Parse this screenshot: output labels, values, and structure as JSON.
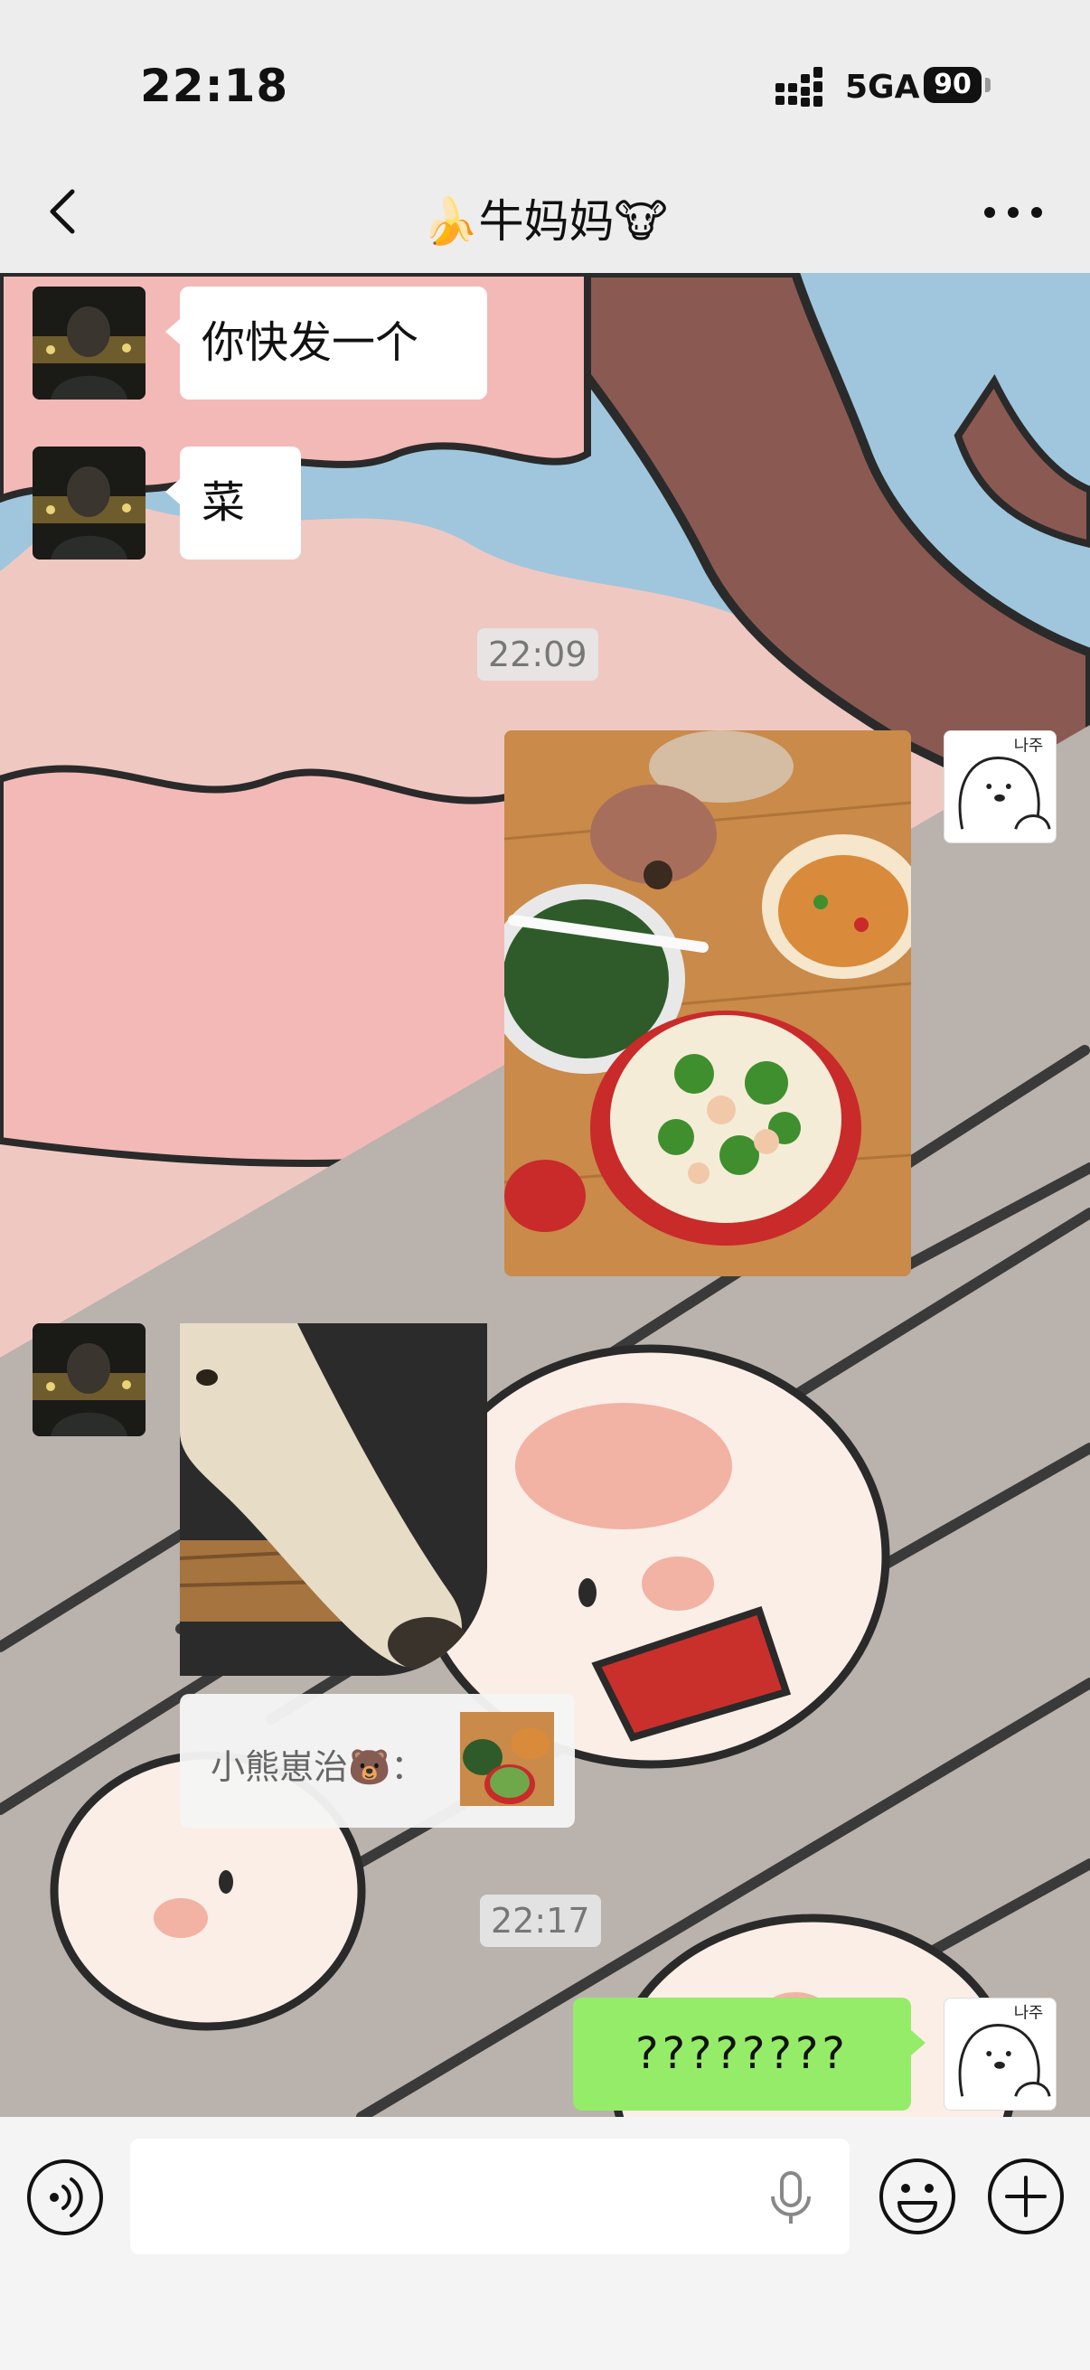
{
  "status_bar": {
    "time": "22:18",
    "network": "5GA",
    "battery": "90"
  },
  "nav": {
    "title": "🍌牛妈妈🐮",
    "back_icon": "chevron-left-icon",
    "more_icon": "ellipsis-icon"
  },
  "messages": [
    {
      "type": "text",
      "side": "left",
      "text": "你快发一个"
    },
    {
      "type": "text",
      "side": "left",
      "text": "菜"
    },
    {
      "type": "timestamp",
      "text": "22:09"
    },
    {
      "type": "image",
      "side": "right",
      "content": "photo of dishes on a table: broccoli with shrimp, spinach soup, stir-fried tofu"
    },
    {
      "type": "image",
      "side": "left",
      "content": "close-up photo of a borzoi dog's long snout"
    },
    {
      "type": "quote",
      "side": "left",
      "text": "小熊崽治🐻："
    },
    {
      "type": "timestamp",
      "text": "22:17"
    },
    {
      "type": "text",
      "side": "right",
      "text": "????????"
    }
  ],
  "thumbnail_overlay": {
    "avatar_text": "나주"
  },
  "input_bar": {
    "value": "",
    "voice_icon": "voice-mode-icon",
    "mic_icon": "microphone-icon",
    "emoji_icon": "emoji-icon",
    "plus_icon": "plus-icon"
  },
  "colors": {
    "header_bg": "#ededed",
    "sent_bubble": "#95ec69",
    "received_bubble": "#ffffff",
    "timestamp_bg": "#e6e6e6"
  }
}
